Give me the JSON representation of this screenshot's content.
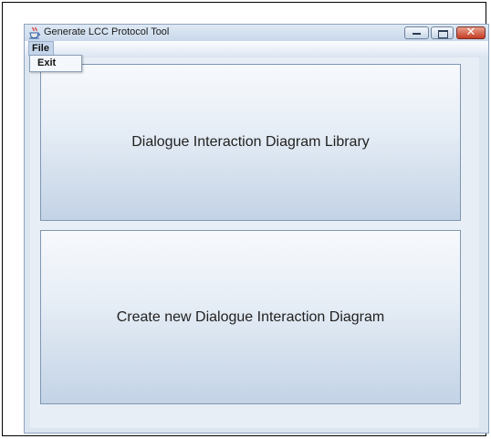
{
  "window": {
    "title": "Generate LCC Protocol Tool"
  },
  "menu": {
    "file_label": "File",
    "file_items": [
      "Exit"
    ]
  },
  "main": {
    "buttons": [
      {
        "label": "Dialogue Interaction Diagram Library"
      },
      {
        "label": "Create new Dialogue Interaction Diagram"
      }
    ]
  },
  "icons": {
    "app": "java-coffee-cup-icon",
    "minimize": "minimize-icon",
    "maximize": "maximize-icon",
    "close": "close-icon"
  },
  "colors": {
    "close_button": "#c33b22",
    "button_gradient_top": "#f7f9fc",
    "button_gradient_bottom": "#c3d3e6"
  }
}
